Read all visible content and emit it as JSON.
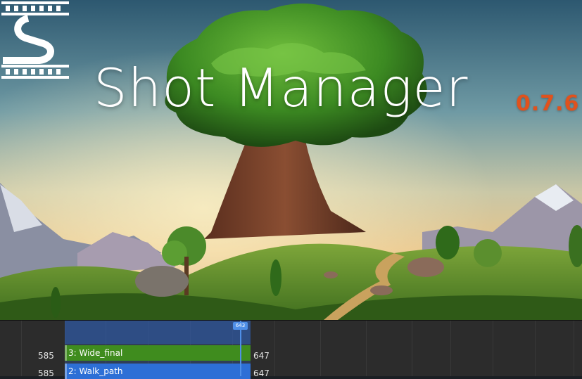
{
  "app": {
    "title": "Shot Manager",
    "version": "0.7.6"
  },
  "colors": {
    "title_text": "#ffffff",
    "version_accent": "#e0521d",
    "shot_green": "#3f8c1e",
    "shot_blue": "#2d6fd6",
    "cursor_blue": "#4f8fe8",
    "timeline_bg": "#2c2c2c"
  },
  "logo": {
    "icon": "shot-manager-logo-icon"
  },
  "timeline": {
    "current_frame": "643",
    "shots": [
      {
        "start": "585",
        "name": "3: Wide_final",
        "end": "647",
        "color": "#3f8c1e"
      },
      {
        "start": "585",
        "name": "2: Walk_path",
        "end": "647",
        "color": "#2d6fd6"
      }
    ]
  }
}
